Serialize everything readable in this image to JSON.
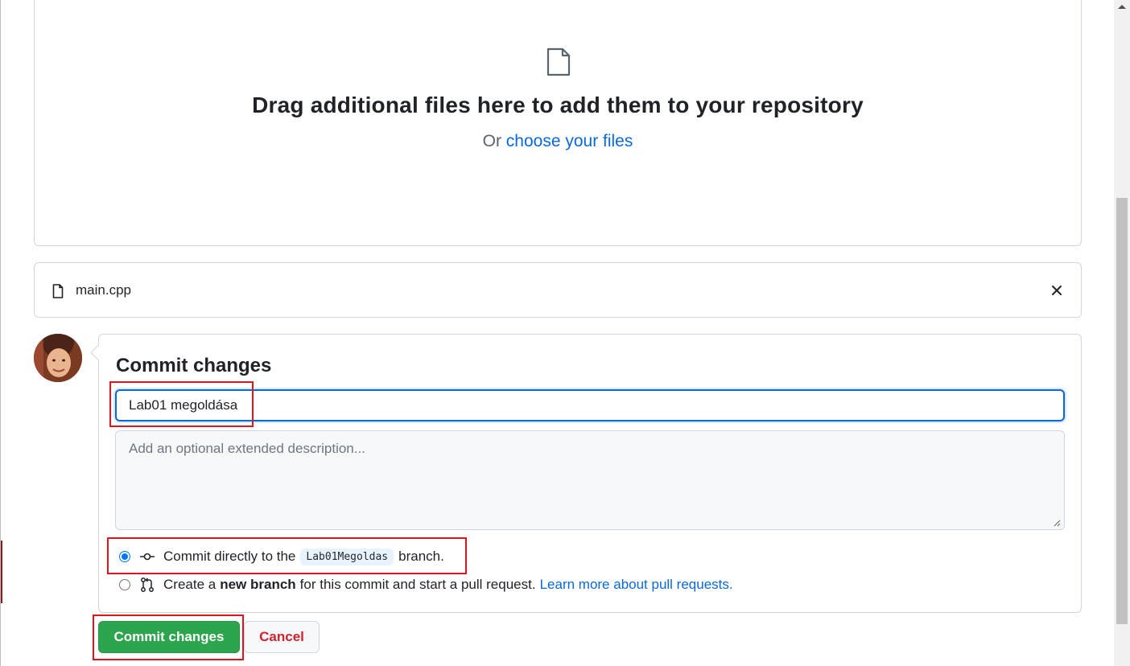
{
  "dropzone": {
    "title": "Drag additional files here to add them to your repository",
    "sub_prefix": "Or",
    "choose_link": "choose your files"
  },
  "file": {
    "name": "main.cpp"
  },
  "commit": {
    "heading": "Commit changes",
    "summary_value": "Lab01 megoldása",
    "description_placeholder": "Add an optional extended description...",
    "option_direct": {
      "prefix": "Commit directly to the",
      "branch": "Lab01Megoldas",
      "suffix": "branch.",
      "selected": true
    },
    "option_new_branch": {
      "prefix": "Create a",
      "bold": "new branch",
      "suffix": "for this commit and start a pull request.",
      "link": "Learn more about pull requests.",
      "selected": false
    }
  },
  "buttons": {
    "commit_label": "Commit changes",
    "cancel_label": "Cancel"
  },
  "colors": {
    "accent": "#0969da",
    "commit_green": "#2da44e",
    "cancel_red": "#cf222e",
    "annotation_red": "#e0141e"
  },
  "icons": {
    "dropzone": "file-icon",
    "file_row": "file-icon",
    "remove": "close-icon",
    "commit": "git-commit-icon",
    "pull_request": "git-pull-request-icon"
  }
}
